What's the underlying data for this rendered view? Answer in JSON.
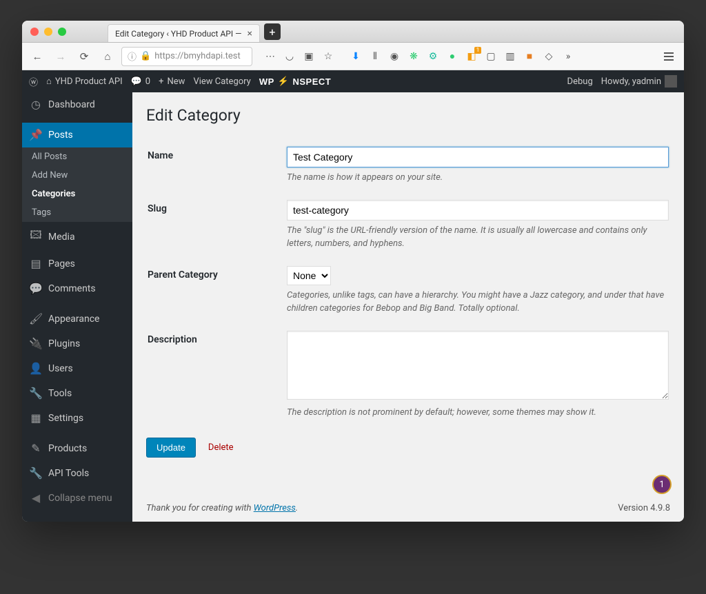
{
  "browser": {
    "tab_title": "Edit Category ‹ YHD Product API —",
    "url": "https://bmyhdapi.test"
  },
  "adminbar": {
    "site_name": "YHD Product API",
    "comments_count": "0",
    "new": "New",
    "view": "View Category",
    "inspect_pre": "WP",
    "inspect_post": "NSPECT",
    "debug": "Debug",
    "howdy": "Howdy, yadmin"
  },
  "sidebar": {
    "dashboard": "Dashboard",
    "posts": "Posts",
    "posts_sub": {
      "all": "All Posts",
      "add": "Add New",
      "cats": "Categories",
      "tags": "Tags"
    },
    "media": "Media",
    "pages": "Pages",
    "comments": "Comments",
    "appearance": "Appearance",
    "plugins": "Plugins",
    "users": "Users",
    "tools": "Tools",
    "settings": "Settings",
    "products": "Products",
    "api_tools": "API Tools",
    "collapse": "Collapse menu"
  },
  "page": {
    "heading": "Edit Category",
    "name_label": "Name",
    "name_value": "Test Category",
    "name_desc": "The name is how it appears on your site.",
    "slug_label": "Slug",
    "slug_value": "test-category",
    "slug_desc": "The \"slug\" is the URL-friendly version of the name. It is usually all lowercase and contains only letters, numbers, and hyphens.",
    "parent_label": "Parent Category",
    "parent_value": "None",
    "parent_desc": "Categories, unlike tags, can have a hierarchy. You might have a Jazz category, and under that have children categories for Bebop and Big Band. Totally optional.",
    "desc_label": "Description",
    "desc_desc": "The description is not prominent by default; however, some themes may show it.",
    "update": "Update",
    "delete": "Delete"
  },
  "footer": {
    "thanks_pre": "Thank you for creating with ",
    "thanks_link": "WordPress",
    "version": "Version 4.9.8"
  },
  "badge": "1"
}
